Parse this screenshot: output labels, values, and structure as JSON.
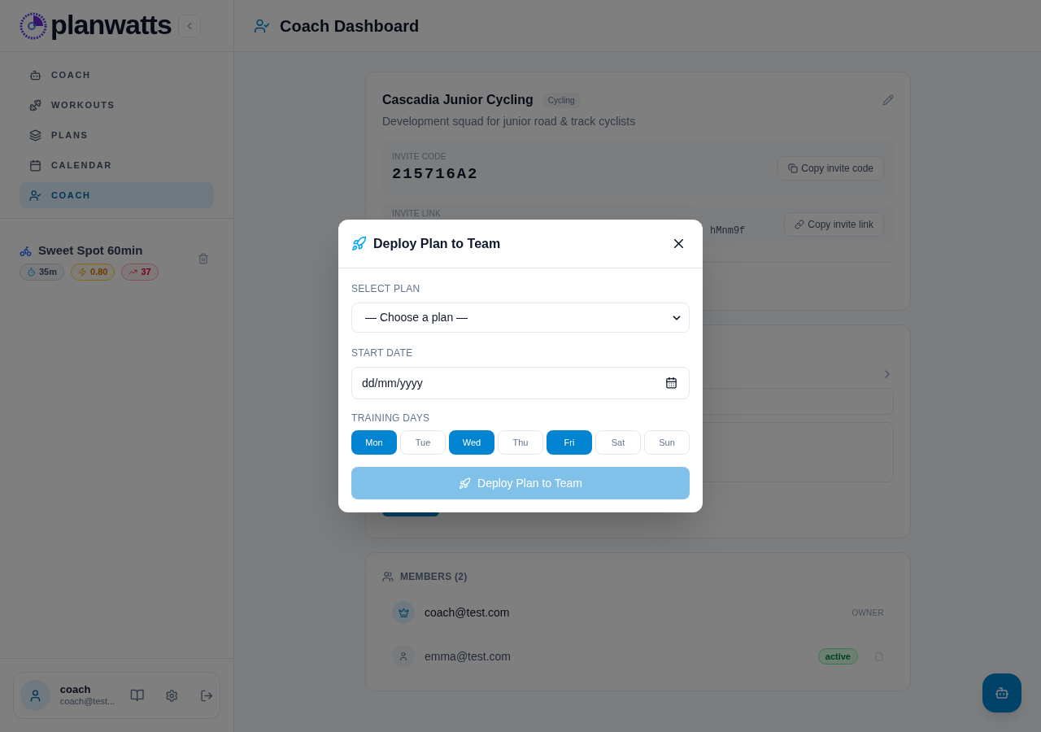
{
  "brand": {
    "name": "planwatts"
  },
  "nav": [
    {
      "label": "COACH",
      "selected": false
    },
    {
      "label": "WORKOUTS",
      "selected": false
    },
    {
      "label": "PLANS",
      "selected": false
    },
    {
      "label": "CALENDAR",
      "selected": false
    },
    {
      "label": "COACH",
      "selected": true
    }
  ],
  "workout": {
    "title": "Sweet Spot 60min",
    "stats": [
      {
        "kind": "duration",
        "value": "35m"
      },
      {
        "kind": "intensity",
        "value": "0.80"
      },
      {
        "kind": "load",
        "value": "37"
      }
    ]
  },
  "user": {
    "name": "coach",
    "email": "coach@test..."
  },
  "header": {
    "title": "Coach Dashboard"
  },
  "team": {
    "name": "Cascadia Junior Cycling",
    "tag": "Cycling",
    "description": "Development squad for junior road & track cyclists",
    "invite_code": {
      "label": "INVITE CODE",
      "value": "215716A2",
      "button": "Copy invite code"
    },
    "invite_link": {
      "label": "INVITE LINK",
      "value": "hMnm9f",
      "button": "Copy invite link"
    }
  },
  "members": {
    "title": "MEMBERS (2)",
    "items": [
      {
        "email": "coach@test.com",
        "kind": "owner",
        "tag": "OWNER"
      },
      {
        "email": "emma@test.com",
        "kind": "member",
        "status": "active"
      }
    ]
  },
  "modal": {
    "title": "Deploy Plan to Team",
    "plan": {
      "label": "SELECT PLAN",
      "value": "— Choose a plan —"
    },
    "start_date": {
      "label": "START DATE",
      "placeholder": "dd/mm/yyyy"
    },
    "days": {
      "label": "TRAINING DAYS",
      "items": [
        {
          "label": "Mon",
          "selected": true
        },
        {
          "label": "Tue",
          "selected": false
        },
        {
          "label": "Wed",
          "selected": true
        },
        {
          "label": "Thu",
          "selected": false
        },
        {
          "label": "Fri",
          "selected": true
        },
        {
          "label": "Sat",
          "selected": false
        },
        {
          "label": "Sun",
          "selected": false
        }
      ]
    },
    "submit": {
      "label": "Deploy Plan to Team",
      "disabled": true
    }
  }
}
